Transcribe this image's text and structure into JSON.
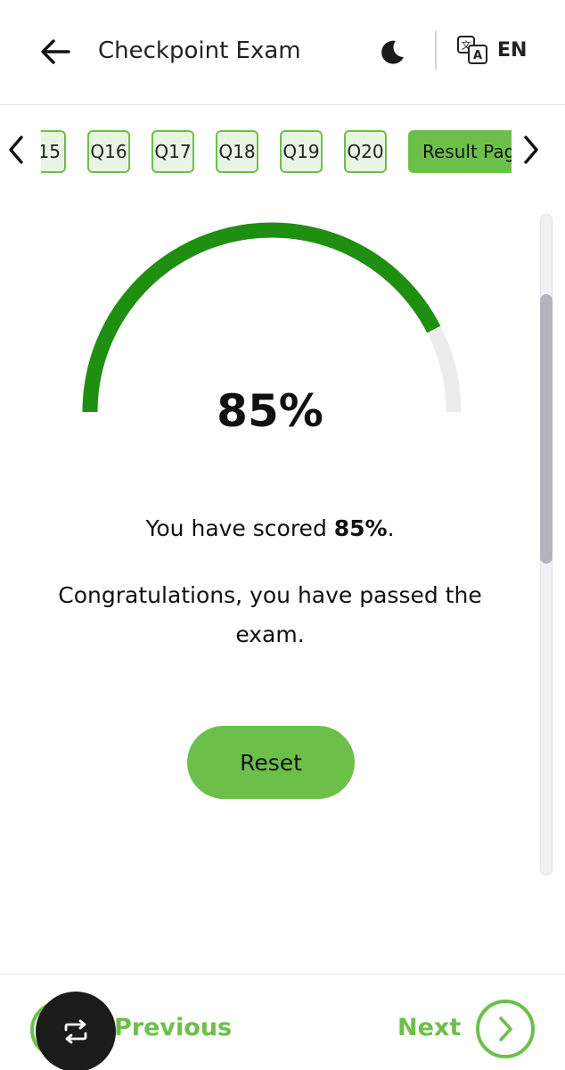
{
  "header": {
    "title": "Checkpoint Exam",
    "language": "EN"
  },
  "question_nav": {
    "items": [
      "15",
      "Q16",
      "Q17",
      "Q18",
      "Q19",
      "Q20"
    ],
    "active_label": "Result Pag"
  },
  "result": {
    "score_percent": 85,
    "score_display": "85%",
    "score_text_prefix": "You have scored ",
    "score_text_value": "85%",
    "score_text_suffix": ".",
    "message": "Congratulations, you have passed the exam.",
    "reset_label": "Reset"
  },
  "footer": {
    "previous_label": "Previous",
    "next_label": "Next"
  },
  "colors": {
    "accent": "#6cc04a",
    "gauge_fill": "#1f8f12",
    "gauge_track": "#ececec"
  },
  "icons": {
    "back": "arrow-left-icon",
    "theme": "moon-icon",
    "language": "translate-icon",
    "prev_nav": "chevron-left-icon",
    "next_nav": "chevron-right-icon",
    "next": "chevron-right-circle-icon",
    "overlay": "repeat-icon"
  }
}
